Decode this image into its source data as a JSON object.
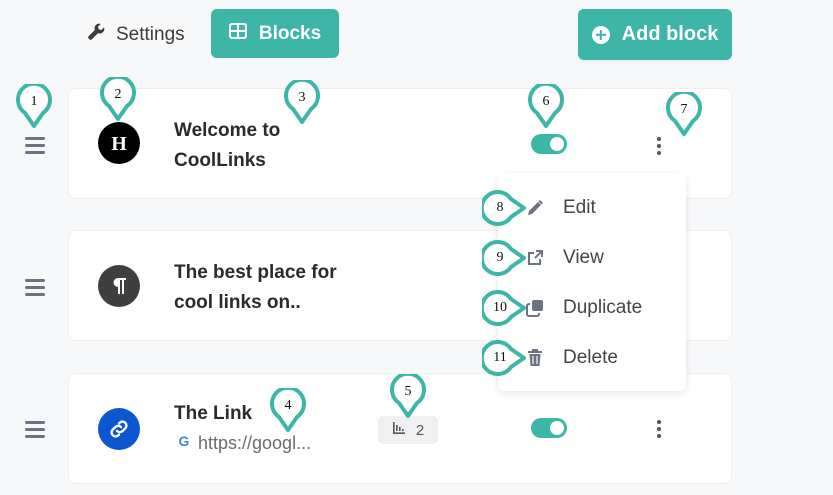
{
  "header": {
    "settings_label": "Settings",
    "blocks_label": "Blocks",
    "add_block_label": "Add block"
  },
  "blocks": [
    {
      "title_line1": "Welcome to",
      "title_line2": "CoolLinks",
      "icon": "heading-icon",
      "enabled": true
    },
    {
      "title_line1": "The best place for",
      "title_line2": "cool links on..",
      "icon": "paragraph-icon"
    },
    {
      "title": "The Link",
      "url": "https://googl...",
      "clicks": "2",
      "icon": "link-icon",
      "enabled": true
    }
  ],
  "menu": {
    "items": [
      {
        "label": "Edit",
        "icon": "pencil-icon"
      },
      {
        "label": "View",
        "icon": "external-link-icon"
      },
      {
        "label": "Duplicate",
        "icon": "copy-icon"
      },
      {
        "label": "Delete",
        "icon": "trash-icon"
      }
    ]
  },
  "markers": [
    "1",
    "2",
    "3",
    "4",
    "5",
    "6",
    "7",
    "8",
    "9",
    "10",
    "11"
  ],
  "colors": {
    "accent": "#3db6a8",
    "marker_stroke": "#3db6a8"
  }
}
